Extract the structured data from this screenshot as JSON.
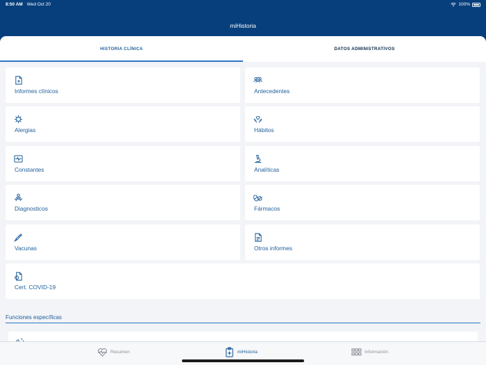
{
  "status_bar": {
    "time": "8:50 AM",
    "date": "Wed Oct 20",
    "battery": "100%",
    "wifi_icon": "wifi-icon",
    "battery_icon": "battery-icon"
  },
  "header": {
    "title": "miHistoria"
  },
  "tabs": [
    {
      "label": "HISTORIA CLÍNICA",
      "active": true
    },
    {
      "label": "DATOS ADMINISTRATIVOS",
      "active": false
    }
  ],
  "cards": [
    {
      "label": "Informes clínicos",
      "icon": "medical-document-icon"
    },
    {
      "label": "Antecedentes",
      "icon": "people-group-icon"
    },
    {
      "label": "Alergias",
      "icon": "allergy-virus-icon"
    },
    {
      "label": "Hábitos",
      "icon": "hands-heart-icon"
    },
    {
      "label": "Constantes",
      "icon": "vital-signs-monitor-icon"
    },
    {
      "label": "Analíticas",
      "icon": "microscope-icon"
    },
    {
      "label": "Diagnosticos",
      "icon": "patient-diagnosis-icon"
    },
    {
      "label": "Fármacos",
      "icon": "pills-icon"
    },
    {
      "label": "Vacunas",
      "icon": "syringe-icon"
    },
    {
      "label": "Otros informes",
      "icon": "document-icon"
    },
    {
      "label": "Cert. COVID-19",
      "icon": "covid-certificate-icon"
    }
  ],
  "section": {
    "title": "Funciones específicas",
    "partial_item_icon": "function-icon"
  },
  "tabbar": [
    {
      "label": "Resumen",
      "icon": "heart-pulse-icon",
      "active": false
    },
    {
      "label": "miHistoria",
      "icon": "clipboard-medical-icon",
      "active": true
    },
    {
      "label": "Información",
      "icon": "grid-icon",
      "active": false
    }
  ],
  "colors": {
    "primary": "#073f7c",
    "accent": "#1f5d99",
    "background": "#f2f4f7"
  }
}
